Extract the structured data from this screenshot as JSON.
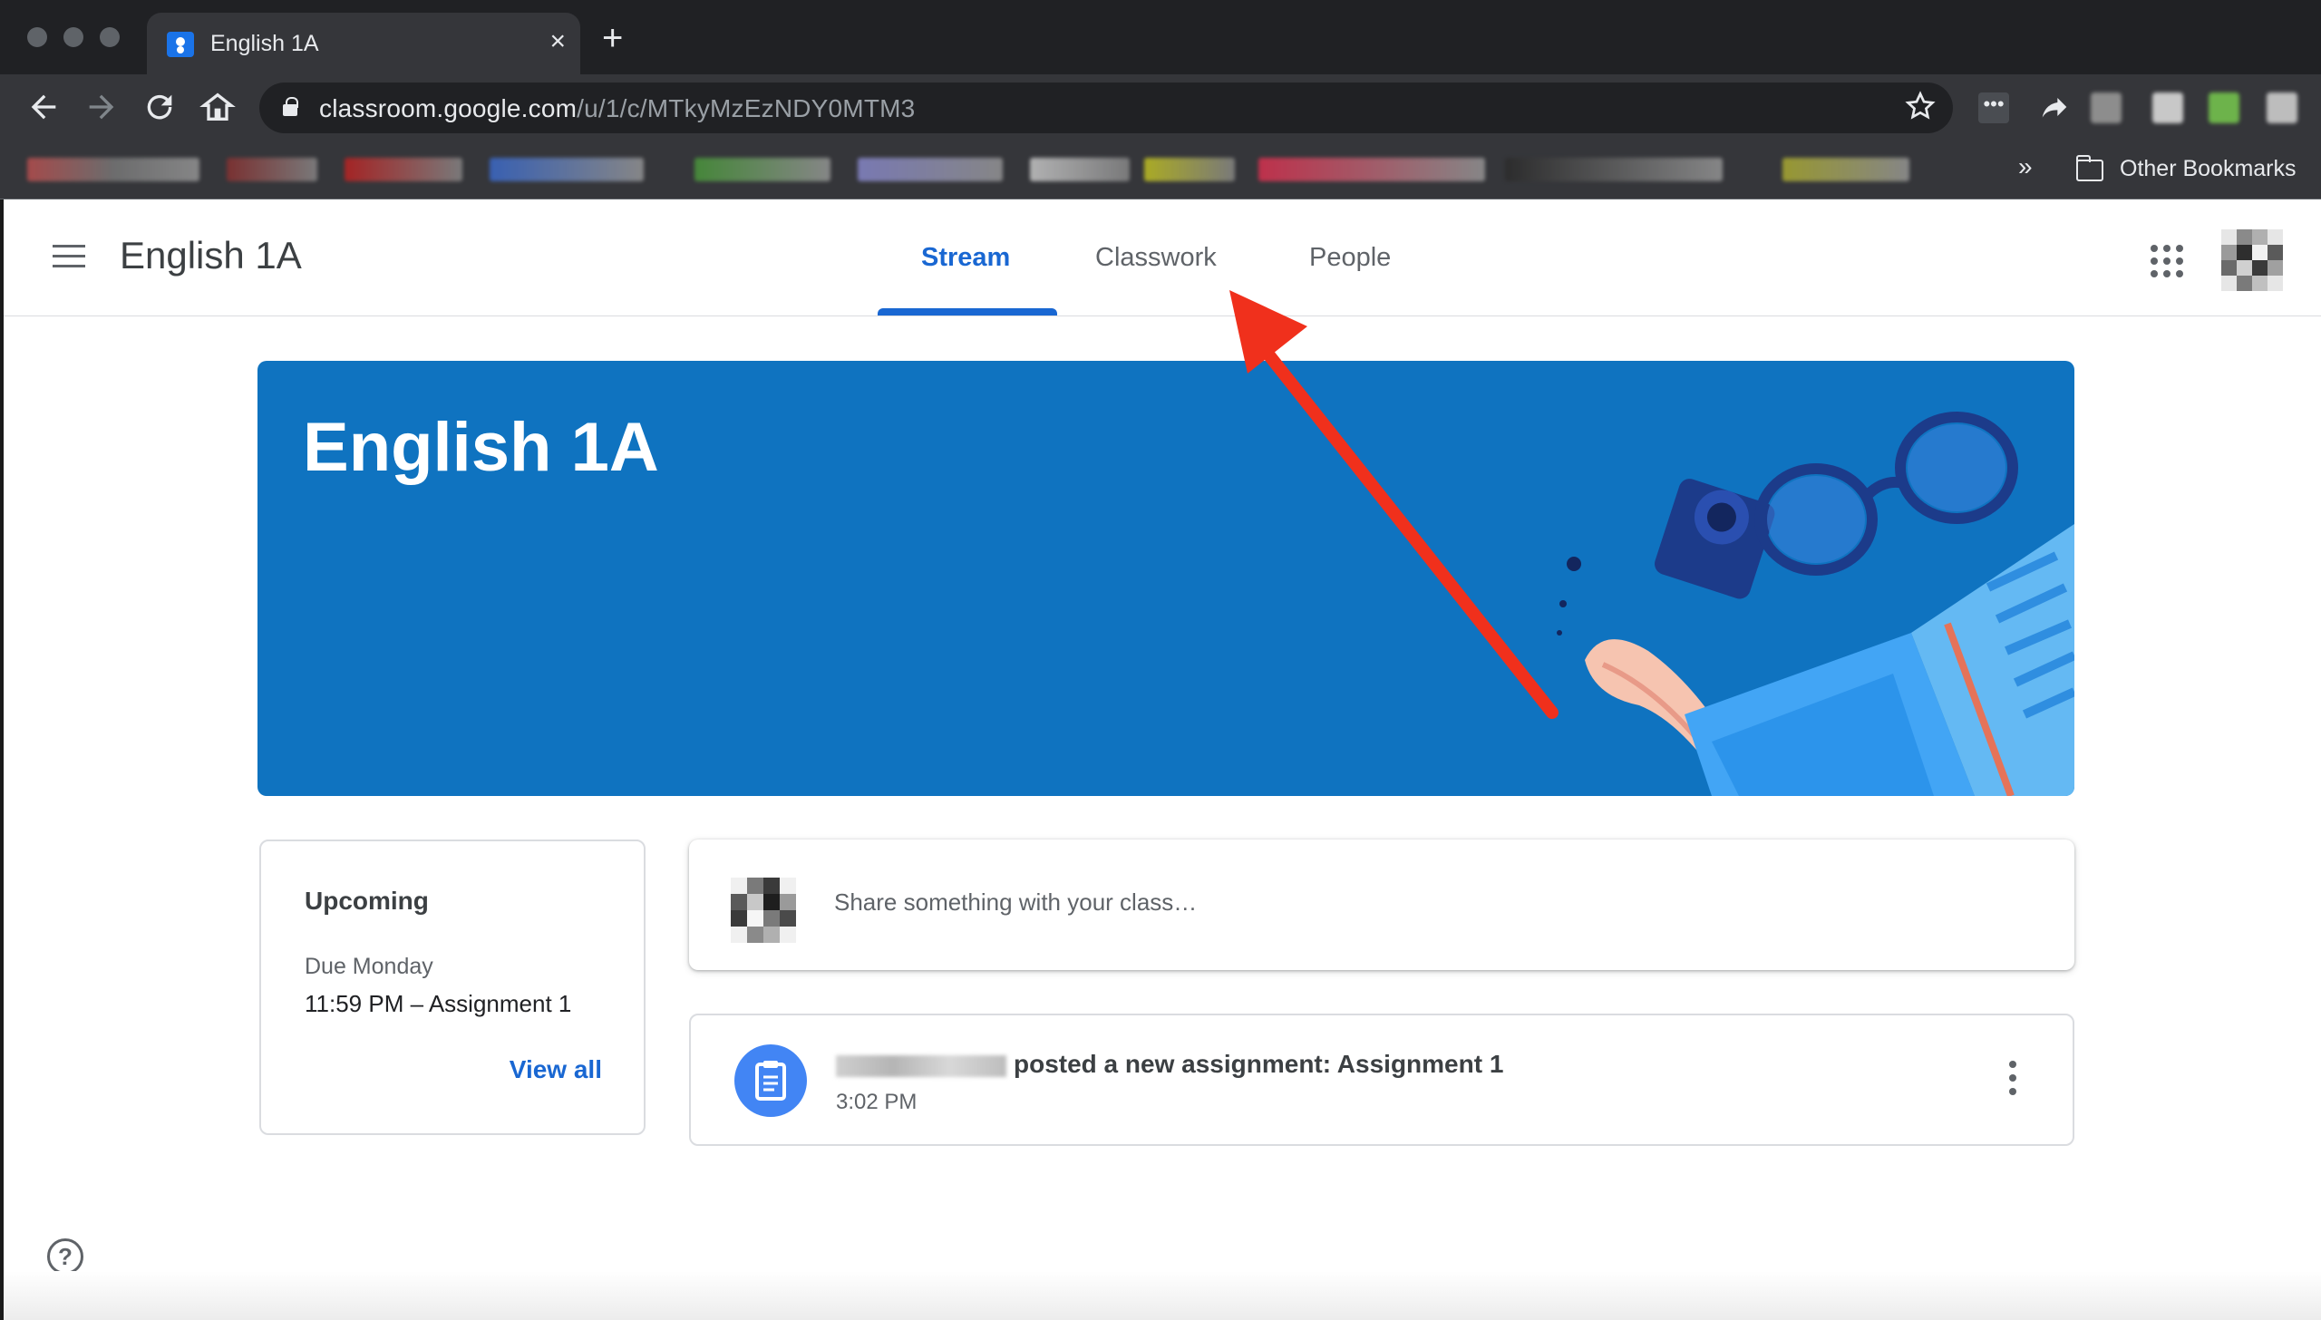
{
  "browser": {
    "tab_title": "English 1A",
    "tab_close": "×",
    "new_tab": "+",
    "url_host": "classroom.google.com",
    "url_path": "/u/1/c/MTkyMzEzNDY0MTM3",
    "bookmarks_overflow": "»",
    "other_bookmarks": "Other Bookmarks",
    "icons": [
      "back-icon",
      "forward-icon",
      "reload-icon",
      "home-icon",
      "lock-icon",
      "star-icon",
      "folder-icon"
    ]
  },
  "app": {
    "class_title": "English 1A",
    "tabs": [
      {
        "label": "Stream",
        "active": true
      },
      {
        "label": "Classwork",
        "active": false
      },
      {
        "label": "People",
        "active": false
      }
    ],
    "accent_color": "#1967d2",
    "banner": {
      "title": "English 1A",
      "color": "#0f73c0"
    },
    "upcoming": {
      "title": "Upcoming",
      "due": "Due Monday",
      "item": "11:59 PM – Assignment 1",
      "view_all": "View all"
    },
    "share": {
      "placeholder": "Share something with your class…"
    },
    "post": {
      "text": "posted a new assignment: Assignment 1",
      "time": "3:02 PM",
      "icon": "assignment-icon"
    },
    "help": "?"
  },
  "annotation": {
    "type": "arrow",
    "color": "#f0301c",
    "points_to": "tab-classwork"
  }
}
